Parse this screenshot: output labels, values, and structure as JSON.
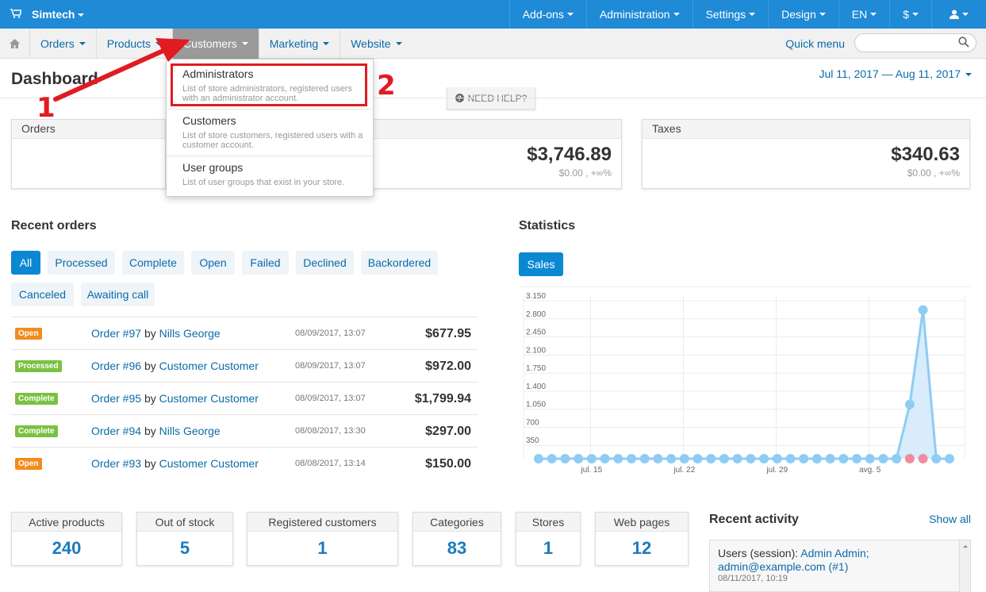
{
  "topbar": {
    "brand": "Simtech",
    "items": [
      "Add-ons",
      "Administration",
      "Settings",
      "Design",
      "EN",
      "$"
    ],
    "colors": {
      "bar": "#1f8ad6",
      "accent": "#0b88d2",
      "annotation": "#e01b22"
    }
  },
  "nav": {
    "items": [
      {
        "label": "Orders"
      },
      {
        "label": "Products"
      },
      {
        "label": "Customers"
      },
      {
        "label": "Marketing"
      },
      {
        "label": "Website"
      }
    ],
    "quick_menu": "Quick menu",
    "search_placeholder": ""
  },
  "dashboard": {
    "title": "Dashboard",
    "date_range": "Jul 11, 2017 — Aug 11, 2017",
    "need_help": "NEED HELP?"
  },
  "customers_menu": {
    "items": [
      {
        "title": "Administrators",
        "desc": "List of store administrators, registered users with an administrator account."
      },
      {
        "title": "Customers",
        "desc": "List of store customers, registered users with a customer account."
      },
      {
        "title": "User groups",
        "desc": "List of user groups that exist in your store."
      }
    ]
  },
  "annotations": {
    "step1": "1",
    "step2": "2"
  },
  "summary": {
    "orders_label": "Orders",
    "sales_value": "$3,746.89",
    "sales_sub": "$0.00 , +∞%",
    "taxes_label": "Taxes",
    "taxes_value": "$340.63",
    "taxes_sub": "$0.00 , +∞%"
  },
  "recent_orders": {
    "title": "Recent orders",
    "filters": [
      "All",
      "Processed",
      "Complete",
      "Open",
      "Failed",
      "Declined",
      "Backordered",
      "Canceled",
      "Awaiting call"
    ],
    "rows": [
      {
        "status": "Open",
        "order": "Order #97",
        "by": "by",
        "customer": "Nills George",
        "date": "08/09/2017, 13:07",
        "amount": "$677.95"
      },
      {
        "status": "Processed",
        "order": "Order #96",
        "by": "by",
        "customer": "Customer Customer",
        "date": "08/09/2017, 13:07",
        "amount": "$972.00"
      },
      {
        "status": "Complete",
        "order": "Order #95",
        "by": "by",
        "customer": "Customer Customer",
        "date": "08/09/2017, 13:07",
        "amount": "$1,799.94"
      },
      {
        "status": "Complete",
        "order": "Order #94",
        "by": "by",
        "customer": "Nills George",
        "date": "08/08/2017, 13:30",
        "amount": "$297.00"
      },
      {
        "status": "Open",
        "order": "Order #93",
        "by": "by",
        "customer": "Customer Customer",
        "date": "08/08/2017, 13:14",
        "amount": "$150.00"
      }
    ]
  },
  "statistics": {
    "title": "Statistics",
    "tab": "Sales"
  },
  "chart_data": {
    "type": "area",
    "title": "",
    "xlabel": "",
    "ylabel": "",
    "y_ticks": [
      "350",
      "700",
      "1.050",
      "1.400",
      "1.750",
      "2.100",
      "2.450",
      "2.800",
      "3.150"
    ],
    "x_ticks": [
      "jul. 15",
      "jul. 22",
      "jul. 29",
      "avg. 5"
    ],
    "ylim": [
      0,
      3150
    ],
    "x": [
      "Jul 11",
      "Jul 12",
      "Jul 13",
      "Jul 14",
      "Jul 15",
      "Jul 16",
      "Jul 17",
      "Jul 18",
      "Jul 19",
      "Jul 20",
      "Jul 21",
      "Jul 22",
      "Jul 23",
      "Jul 24",
      "Jul 25",
      "Jul 26",
      "Jul 27",
      "Jul 28",
      "Jul 29",
      "Jul 30",
      "Jul 31",
      "Aug 1",
      "Aug 2",
      "Aug 3",
      "Aug 4",
      "Aug 5",
      "Aug 6",
      "Aug 7",
      "Aug 8",
      "Aug 9",
      "Aug 10",
      "Aug 11"
    ],
    "series": [
      {
        "values": [
          0,
          0,
          0,
          0,
          0,
          0,
          0,
          0,
          0,
          0,
          0,
          0,
          0,
          0,
          0,
          0,
          0,
          0,
          0,
          0,
          0,
          0,
          0,
          0,
          0,
          0,
          0,
          0,
          1050,
          2880,
          0,
          0
        ],
        "color": "#8fccf3"
      },
      {
        "values": [
          0,
          0,
          0,
          0,
          0,
          0,
          0,
          0,
          0,
          0,
          0,
          0,
          0,
          0,
          0,
          0,
          0,
          0,
          0,
          0,
          0,
          0,
          0,
          0,
          0,
          0,
          0,
          0,
          0,
          0,
          0,
          0
        ],
        "color": "#f08ca0"
      }
    ]
  },
  "counters": [
    {
      "label": "Active products",
      "value": "240"
    },
    {
      "label": "Out of stock",
      "value": "5"
    },
    {
      "label": "Registered customers",
      "value": "1"
    },
    {
      "label": "Categories",
      "value": "83"
    },
    {
      "label": "Stores",
      "value": "1"
    },
    {
      "label": "Web pages",
      "value": "12"
    }
  ],
  "activity": {
    "title": "Recent activity",
    "show_all": "Show all",
    "item_prefix": "Users (session): ",
    "item_link": "Admin Admin; admin@example.com (#1)",
    "item_date": "08/11/2017, 10:19"
  }
}
